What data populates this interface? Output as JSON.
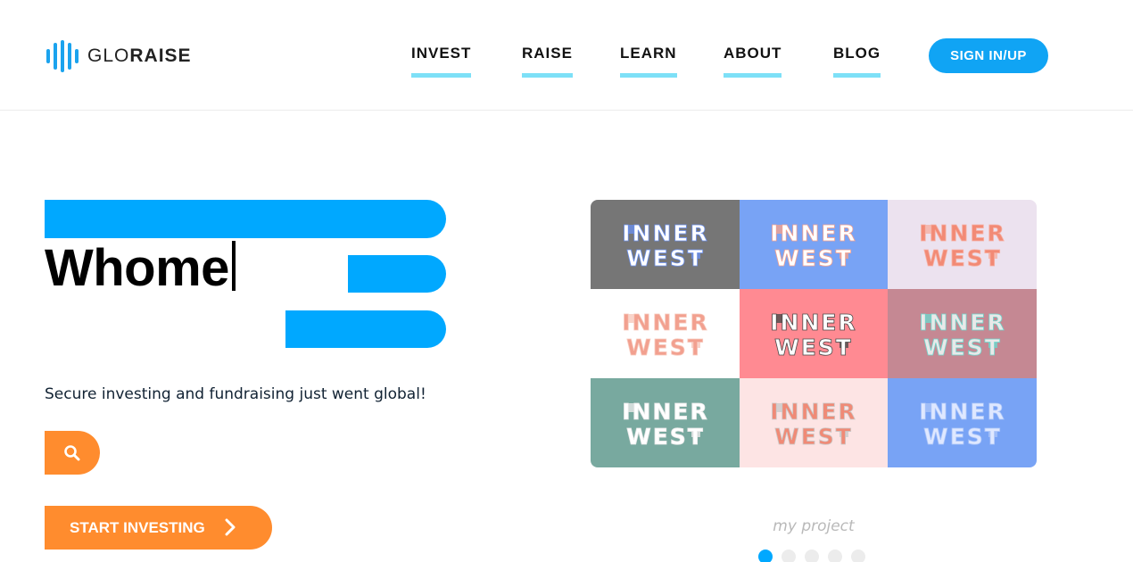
{
  "brand": {
    "logo_light": "GLO",
    "logo_bold": "RAISE",
    "accent": "#10a4f4"
  },
  "nav": {
    "items": [
      {
        "label": "INVEST"
      },
      {
        "label": "RAISE"
      },
      {
        "label": "LEARN"
      },
      {
        "label": "ABOUT"
      },
      {
        "label": "BLOG"
      }
    ],
    "signin_label": "SIGN IN/UP"
  },
  "hero": {
    "typed_text": "Whome",
    "tagline": "Secure investing and fundraising just went global!",
    "search_icon": "search-icon",
    "start_label": "START INVESTING",
    "start_icon": "chevron-right-icon",
    "button_color": "#ff8c2e"
  },
  "gallery": {
    "word_top": "INNER",
    "word_bottom": "WEST",
    "tiles": [
      {
        "bg": "#767676",
        "fg": "#ffffff",
        "accent": "#6a8eea"
      },
      {
        "bg": "#78a3f5",
        "fg": "#ffffff",
        "accent": "#f2a08f"
      },
      {
        "bg": "#ece2ef",
        "fg": "#f28a75",
        "accent": "#f6b0a3"
      },
      {
        "bg": "#ffffff",
        "fg": "#f2a08f",
        "accent": "#f7c9bd"
      },
      {
        "bg": "#ff8a92",
        "fg": "#ffffff",
        "accent": "#4a4a4a"
      },
      {
        "bg": "#c58893",
        "fg": "#e9e9e9",
        "accent": "#6fd6cc"
      },
      {
        "bg": "#78a99f",
        "fg": "#ffffff",
        "accent": "#e9e9e9"
      },
      {
        "bg": "#fde4e4",
        "fg": "#f08a76",
        "accent": "#c9c9c9"
      },
      {
        "bg": "#78a3f5",
        "fg": "#dfe8ff",
        "accent": "#a9c3f9"
      }
    ],
    "caption": "my project",
    "dots": 5,
    "active_dot": 0
  }
}
